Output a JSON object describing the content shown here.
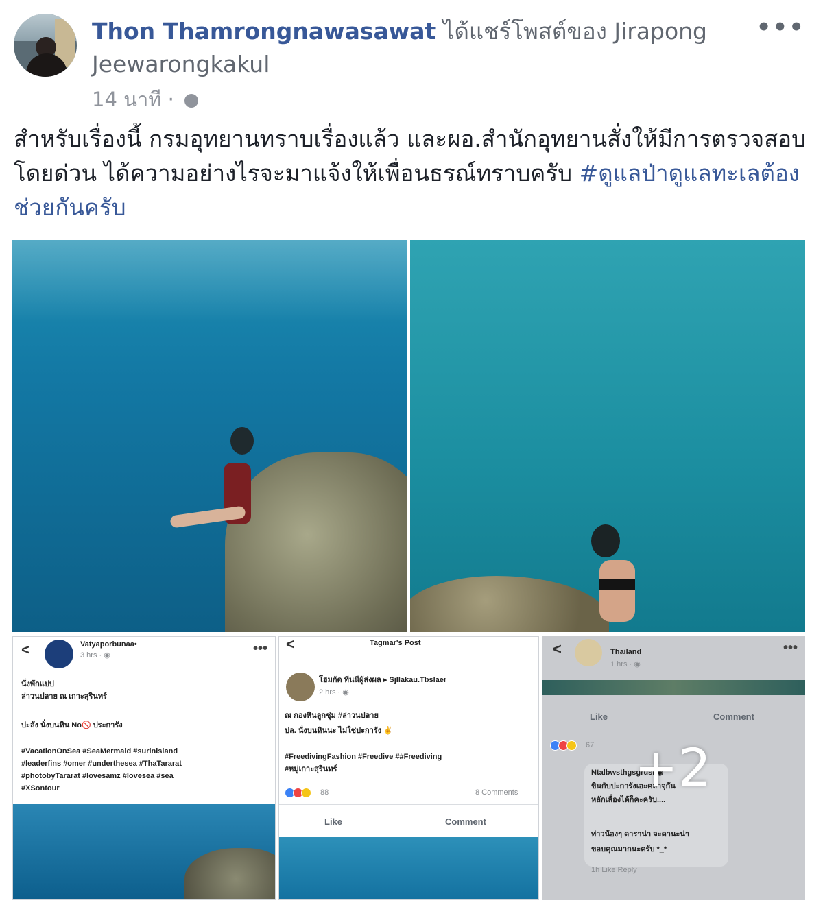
{
  "header": {
    "author": "Thon Thamrongnawasawat",
    "shared_verb": "ได้แชร์โพสต์ของ",
    "shared_from": "Jirapong Jeewarongkakul",
    "time": "14 นาที",
    "separator": "·",
    "privacy_icon": "globe-icon",
    "more_icon": "•••"
  },
  "post": {
    "text": "สำหรับเรื่องนี้ กรมอุทยานทราบเรื่องแล้ว และผอ.สำนักอุทยานสั่งให้มีการตรวจสอบโดยด่วน ได้ความอย่างไรจะมาแจ้งให้เพื่อนธรณ์ทราบครับ",
    "hashtag": "#ดูแลป่าดูแลทะเลต้องช่วยกันครับ"
  },
  "gallery": {
    "more_count": "+2",
    "thumb1": {
      "back": "<",
      "more": "•••",
      "name": "Vatyaporbunaa•",
      "time": "3 hrs · ◉",
      "line1": "นั่งพักแปป",
      "line2": "ล่าวนปลาย ณ เกาะสุรินทร์",
      "line3": "ปะลัง นั่งบนหิน No🚫 ประการัง",
      "tags": "#VacationOnSea #SeaMermaid #surinisland\n#leaderfins #omer #underthesea #ThaTararat\n#photobyTararat #lovesamz #lovesea #sea\n#XSontour"
    },
    "thumb2": {
      "back": "<",
      "title": "Tagmar's Post",
      "name": "โฮมกัด ทีนนีผู้ส่งผล ▸ Sjllakau.Tbslaer",
      "time": "2 hrs · ◉",
      "line1": "ณ กองหินลูกชุ่ม #ล่าวนปลาย",
      "line2": "ปล. นั่งบนหินนะ ไม่ใช่ปะการัง ✌",
      "tags": "#FreedivingFashion #Freedive ##Freediving\n#หมู่เกาะสุรินทร์",
      "reactions": "88",
      "comments": "8 Comments",
      "like": "Like",
      "comment": "Comment"
    },
    "thumb3": {
      "back": "<",
      "more": "•••",
      "name": "Thailand",
      "time": "1 hrs · ◉",
      "like": "Like",
      "comment": "Comment",
      "reactions": "67",
      "comment_name": "Ntalbwsthgsgrusi ◉",
      "comment_line1": "ขินกับปะการังเอะคลาจุกัน",
      "comment_line2": "หลักเลื่องได้ก็คะครับ....",
      "reply_line1": "ท่าวน้องๆ ดาราน่า จะดานะน่า",
      "reply_line2": "ขอบคุณมากนะครับ *_*",
      "reply_meta": "1h  Like  Reply"
    }
  }
}
